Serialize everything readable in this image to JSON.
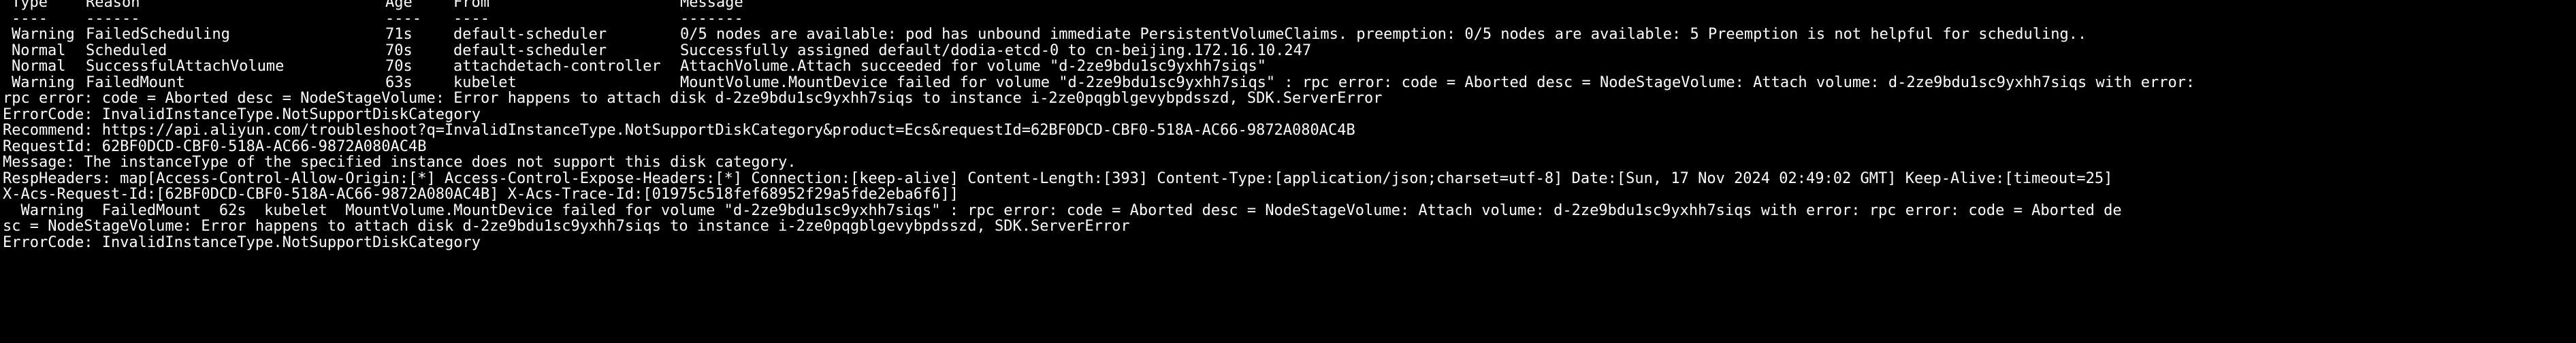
{
  "terminal": {
    "header": {
      "type": "Type",
      "reason": "Reason",
      "age": "Age",
      "from": "From",
      "message": "Message"
    },
    "underline": {
      "type": "----",
      "reason": "------",
      "age": "----",
      "from": "----",
      "message": "-------"
    },
    "events": [
      {
        "type": "Warning",
        "reason": "FailedScheduling",
        "age": "71s",
        "from": "default-scheduler",
        "message": "0/5 nodes are available: pod has unbound immediate PersistentVolumeClaims. preemption: 0/5 nodes are available: 5 Preemption is not helpful for scheduling.."
      },
      {
        "type": "Normal",
        "reason": "Scheduled",
        "age": "70s",
        "from": "default-scheduler",
        "message": "Successfully assigned default/dodia-etcd-0 to cn-beijing.172.16.10.247"
      },
      {
        "type": "Normal",
        "reason": "SuccessfulAttachVolume",
        "age": "70s",
        "from": "attachdetach-controller",
        "message": "AttachVolume.Attach succeeded for volume \"d-2ze9bdu1sc9yxhh7siqs\""
      },
      {
        "type": "Warning",
        "reason": "FailedMount",
        "age": "63s",
        "from": "kubelet",
        "message": "MountVolume.MountDevice failed for volume \"d-2ze9bdu1sc9yxhh7siqs\" : rpc error: code = Aborted desc = NodeStageVolume: Attach volume: d-2ze9bdu1sc9yxhh7siqs with error:"
      }
    ],
    "lines": [
      "rpc error: code = Aborted desc = NodeStageVolume: Error happens to attach disk d-2ze9bdu1sc9yxhh7siqs to instance i-2ze0pqgblgevybpdsszd, SDK.ServerError",
      "ErrorCode: InvalidInstanceType.NotSupportDiskCategory",
      "Recommend: https://api.aliyun.com/troubleshoot?q=InvalidInstanceType.NotSupportDiskCategory&product=Ecs&requestId=62BF0DCD-CBF0-518A-AC66-9872A080AC4B",
      "RequestId: 62BF0DCD-CBF0-518A-AC66-9872A080AC4B",
      "Message: The instanceType of the specified instance does not support this disk category.",
      "RespHeaders: map[Access-Control-Allow-Origin:[*] Access-Control-Expose-Headers:[*] Connection:[keep-alive] Content-Length:[393] Content-Type:[application/json;charset=utf-8] Date:[Sun, 17 Nov 2024 02:49:02 GMT] Keep-Alive:[timeout=25]",
      "X-Acs-Request-Id:[62BF0DCD-CBF0-518A-AC66-9872A080AC4B] X-Acs-Trace-Id:[01975c518fef68952f29a5fde2eba6f6]]",
      "  Warning  FailedMount  62s  kubelet  MountVolume.MountDevice failed for volume \"d-2ze9bdu1sc9yxhh7siqs\" : rpc error: code = Aborted desc = NodeStageVolume: Attach volume: d-2ze9bdu1sc9yxhh7siqs with error: rpc error: code = Aborted de",
      "sc = NodeStageVolume: Error happens to attach disk d-2ze9bdu1sc9yxhh7siqs to instance i-2ze0pqgblgevybpdsszd, SDK.ServerError",
      "ErrorCode: InvalidInstanceType.NotSupportDiskCategory"
    ]
  }
}
